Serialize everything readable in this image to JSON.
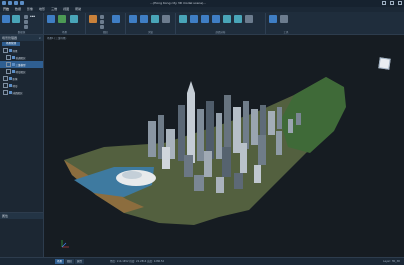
{
  "window": {
    "title": "…(Hong Kong city 3D model scene)…"
  },
  "menu": [
    "开始",
    "数据",
    "影像",
    "地形",
    "三维",
    "视图",
    "帮助"
  ],
  "ribbon": {
    "groups": [
      {
        "caption": "数据源"
      },
      {
        "caption": "场景"
      },
      {
        "caption": "图层"
      },
      {
        "caption": "浏览"
      },
      {
        "caption": "剖面分析"
      },
      {
        "caption": "工具"
      }
    ]
  },
  "sidebar": {
    "title": "场景管理器",
    "tab": "场景管理",
    "items": [
      "场景",
      "普通图层",
      "三维模型",
      "地形图层",
      "影像",
      "地形",
      "球面图层"
    ],
    "attr_title": "属性"
  },
  "viewport": {
    "tab_label": "场景1 (三维场景)"
  },
  "status": {
    "tabs": [
      "场景",
      "图层",
      "属性"
    ],
    "coords": "经度: 114.1652  纬度: 22.2814  高度: 1286.52",
    "right": "Layer: HK_3D"
  },
  "colors": {
    "accent": "#2f5f92",
    "ribbon": "#1f2d3c",
    "background": "#141b24"
  }
}
